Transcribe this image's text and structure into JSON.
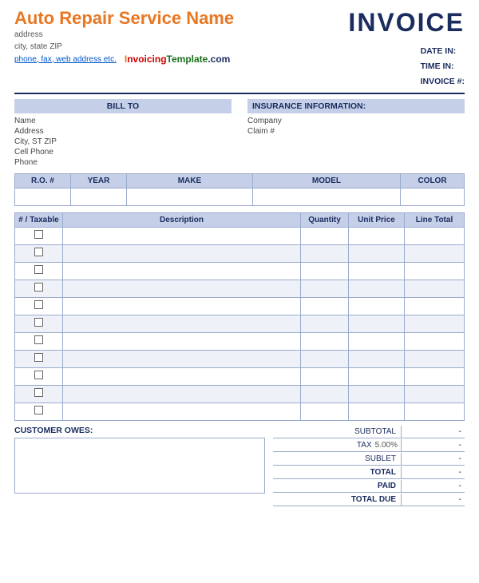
{
  "header": {
    "company_name": "Auto Repair Service Name",
    "invoice_title": "INVOICE",
    "address1": "address",
    "address2": "city, state ZIP",
    "phone": "phone, fax, web address etc.",
    "watermark": "InvoicingTemplate.com",
    "date_in_label": "DATE IN:",
    "time_in_label": "TIME IN:",
    "invoice_num_label": "INVOICE #:"
  },
  "bill_to": {
    "header": "BILL TO",
    "fields": [
      {
        "label": "Name",
        "value": ""
      },
      {
        "label": "Address",
        "value": ""
      },
      {
        "label": "City, ST ZIP",
        "value": ""
      },
      {
        "label": "Cell Phone",
        "value": ""
      },
      {
        "label": "Phone",
        "value": ""
      }
    ]
  },
  "insurance": {
    "header": "INSURANCE INFORMATION:",
    "fields": [
      {
        "label": "Company",
        "value": ""
      },
      {
        "label": "Claim #",
        "value": ""
      }
    ]
  },
  "vehicle": {
    "columns": [
      "R.O. #",
      "YEAR",
      "MAKE",
      "MODEL",
      "COLOR"
    ]
  },
  "items": {
    "columns": [
      "# / Taxable",
      "Description",
      "Quantity",
      "Unit Price",
      "Line Total"
    ],
    "rows": 11
  },
  "totals": {
    "subtotal_label": "SUBTOTAL",
    "subtotal_value": "-",
    "tax_label": "TAX",
    "tax_pct": "5.00%",
    "tax_value": "-",
    "sublet_label": "SUBLET",
    "sublet_value": "-",
    "total_label": "TOTAL",
    "total_value": "-",
    "paid_label": "PAID",
    "paid_value": "-",
    "total_due_label": "TOTAL DUE",
    "total_due_value": "-"
  },
  "customer_owes": {
    "label": "CUSTOMER OWES:"
  }
}
